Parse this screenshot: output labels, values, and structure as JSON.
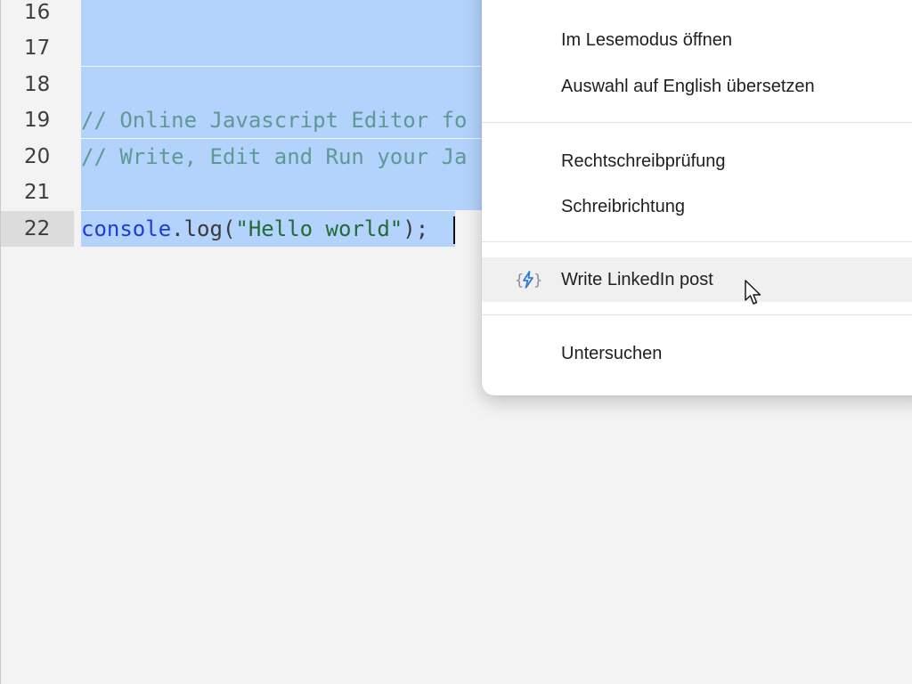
{
  "editor": {
    "lines": [
      {
        "num": "16",
        "text": ""
      },
      {
        "num": "17",
        "text": ""
      },
      {
        "num": "18",
        "text": ""
      },
      {
        "num": "19",
        "comment": "// Online Javascript Editor fo"
      },
      {
        "num": "20",
        "comment": "// Write, Edit and Run your Ja"
      },
      {
        "num": "21",
        "text": ""
      },
      {
        "num": "22",
        "kw": "console",
        "dot": ".",
        "fn": "log(",
        "str": "\"Hello world\"",
        "end": ");"
      }
    ]
  },
  "context_menu": {
    "items": [
      {
        "label": "Im Lesemodus öffnen"
      },
      {
        "label": "Auswahl auf English übersetzen"
      },
      {
        "label": "Rechtschreibprüfung"
      },
      {
        "label": "Schreibrichtung"
      },
      {
        "label": "Write LinkedIn post",
        "icon": "ai-compose-icon"
      },
      {
        "label": "Untersuchen"
      }
    ]
  },
  "colors": {
    "selection": "#b3d3fd",
    "comment": "#5d9a94",
    "keyword": "#1e3bd8",
    "string": "#236b36",
    "icon_accent": "#2b7be0"
  }
}
